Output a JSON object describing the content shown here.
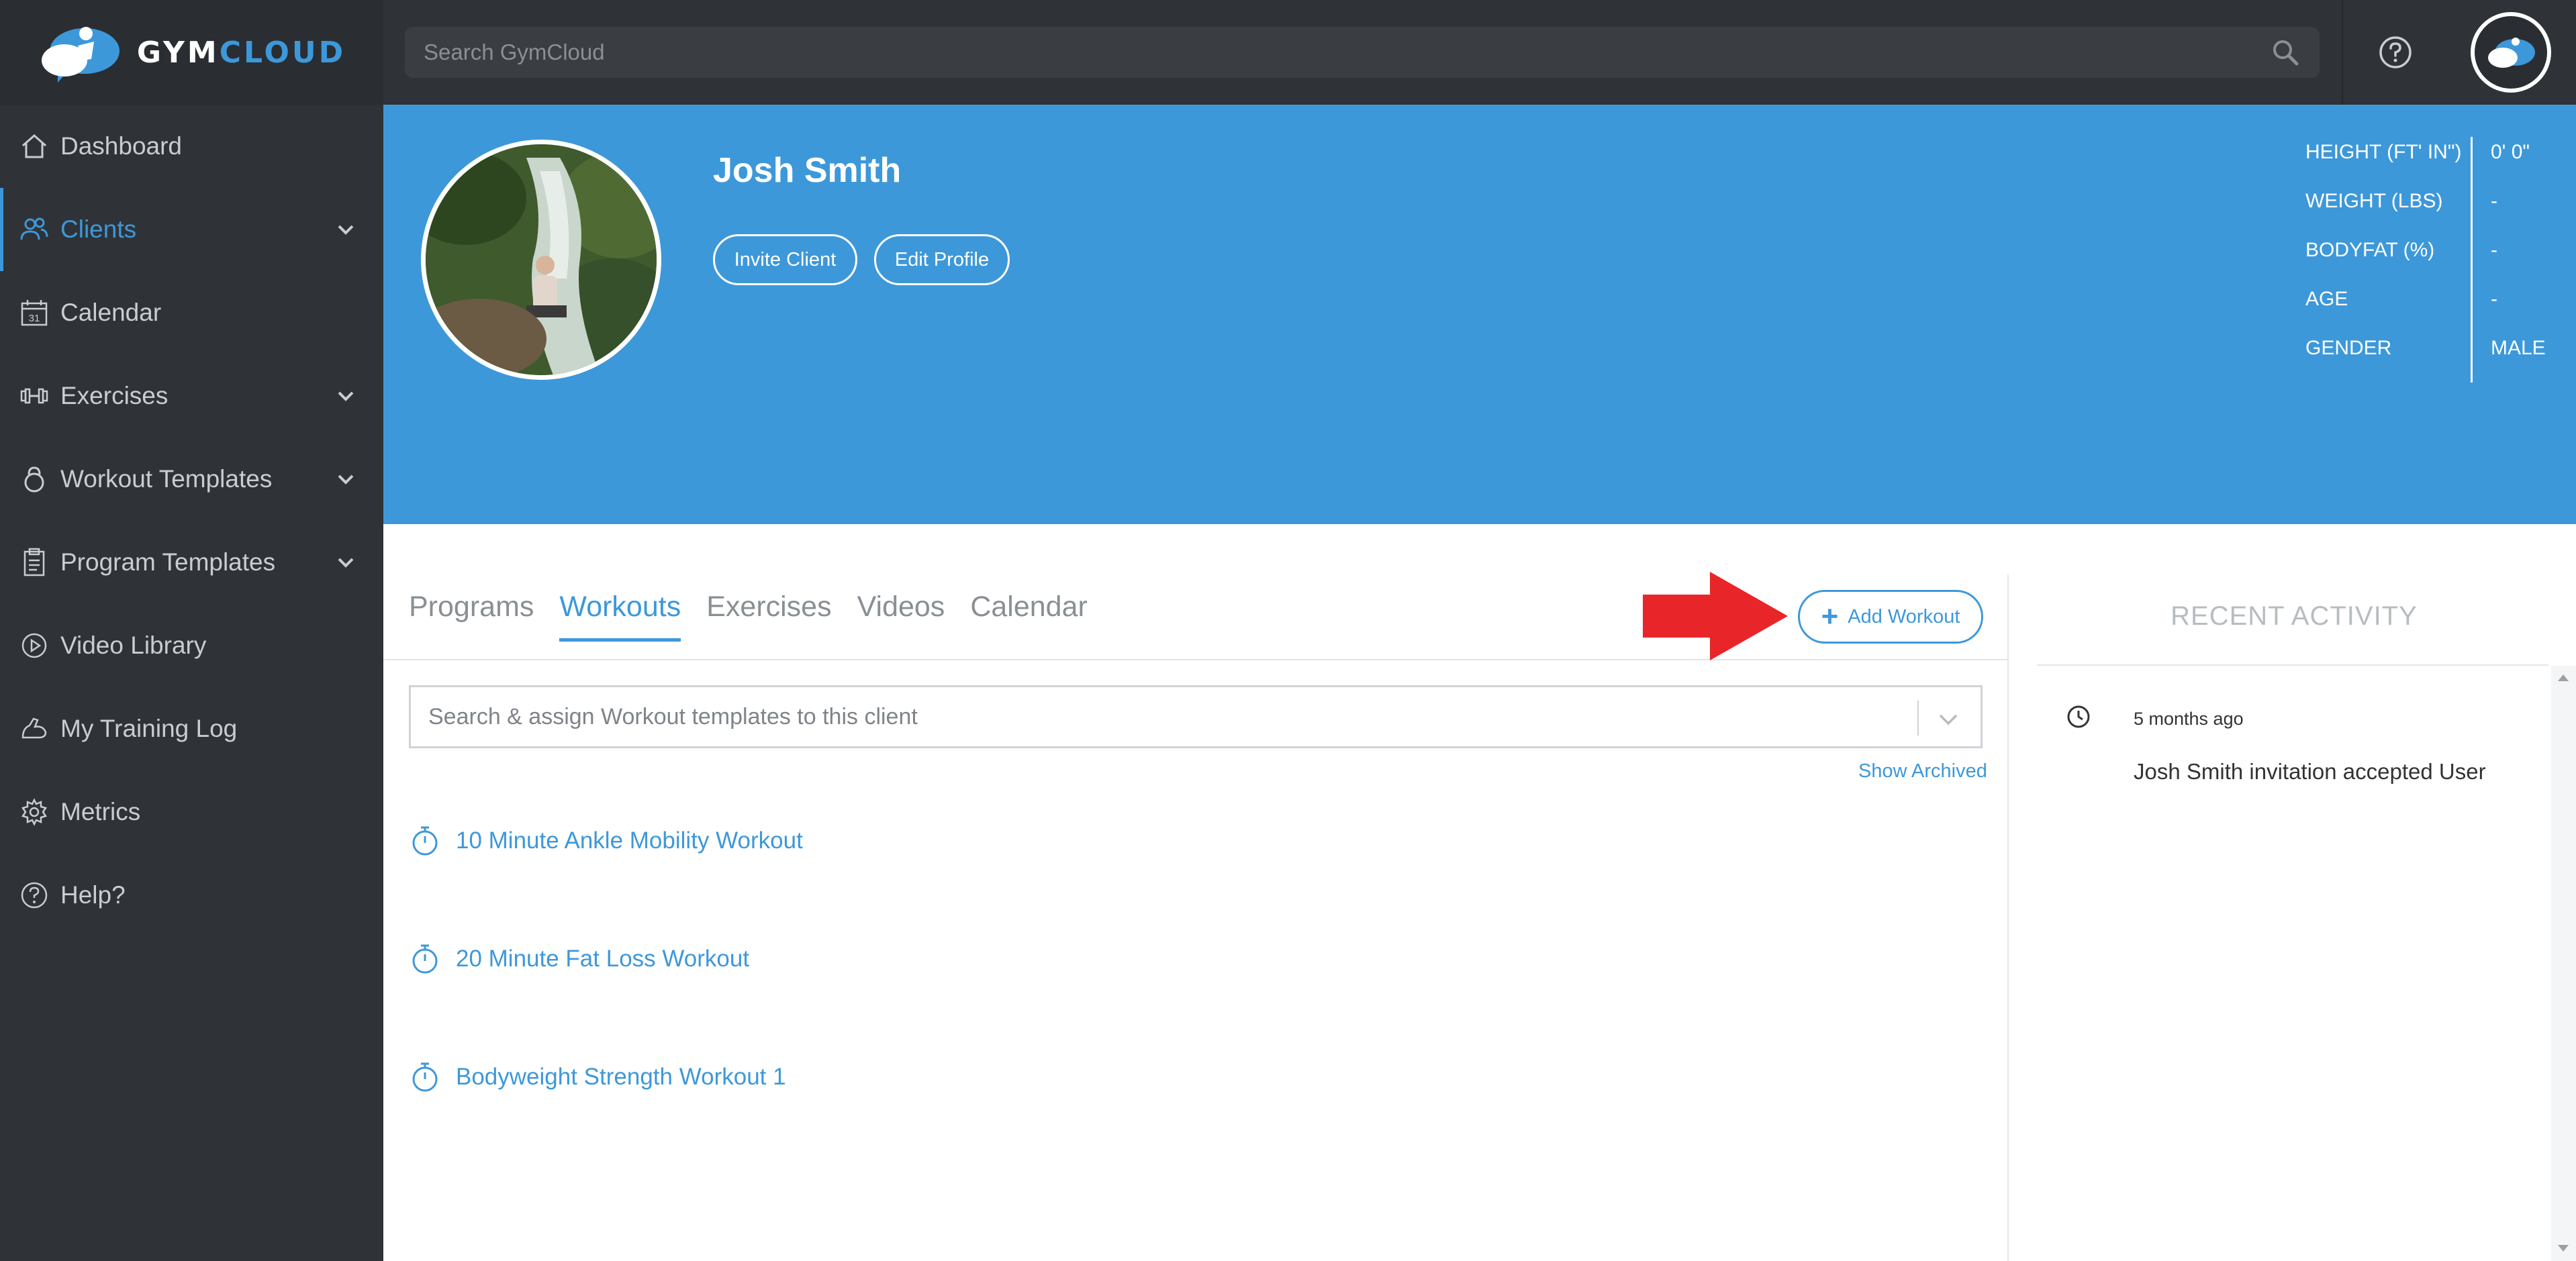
{
  "app": {
    "brand_part1": "GYM",
    "brand_part2": "CLOUD",
    "accent_color": "#3d98da"
  },
  "search": {
    "placeholder": "Search GymCloud"
  },
  "sidebar": {
    "items": [
      {
        "label": "Dashboard",
        "icon": "home-icon"
      },
      {
        "label": "Clients",
        "icon": "users-icon",
        "active": true,
        "expandable": true
      },
      {
        "label": "Calendar",
        "icon": "calendar-icon"
      },
      {
        "label": "Exercises",
        "icon": "dumbbell-icon",
        "expandable": true
      },
      {
        "label": "Workout Templates",
        "icon": "kettlebell-icon",
        "expandable": true
      },
      {
        "label": "Program Templates",
        "icon": "clipboard-icon",
        "expandable": true
      },
      {
        "label": "Video Library",
        "icon": "play-circle-icon"
      },
      {
        "label": "My Training Log",
        "icon": "flex-arm-icon"
      },
      {
        "label": "Metrics",
        "icon": "gear-icon"
      },
      {
        "label": "Help?",
        "icon": "help-circle-icon"
      }
    ],
    "calendar_day": "31"
  },
  "profile": {
    "name": "Josh Smith",
    "invite_label": "Invite Client",
    "edit_label": "Edit Profile",
    "stats": [
      {
        "label": "HEIGHT (FT' IN\")",
        "value": "0' 0\""
      },
      {
        "label": "WEIGHT (LBS)",
        "value": "-"
      },
      {
        "label": "BODYFAT (%)",
        "value": "-"
      },
      {
        "label": "AGE",
        "value": "-"
      },
      {
        "label": "GENDER",
        "value": "MALE"
      }
    ]
  },
  "tabs": [
    {
      "label": "Programs"
    },
    {
      "label": "Workouts",
      "active": true
    },
    {
      "label": "Exercises"
    },
    {
      "label": "Videos"
    },
    {
      "label": "Calendar"
    }
  ],
  "add_workout": {
    "plus": "+",
    "label": "Add Workout"
  },
  "assign": {
    "placeholder": "Search & assign Workout templates to this client"
  },
  "show_archived": "Show Archived",
  "workouts": [
    {
      "name": "10 Minute Ankle Mobility Workout"
    },
    {
      "name": "20 Minute Fat Loss Workout"
    },
    {
      "name": "Bodyweight Strength Workout 1"
    }
  ],
  "recent_activity": {
    "title": "RECENT ACTIVITY",
    "items": [
      {
        "time": "5 months ago",
        "text": "Josh Smith invitation accepted User"
      }
    ]
  }
}
